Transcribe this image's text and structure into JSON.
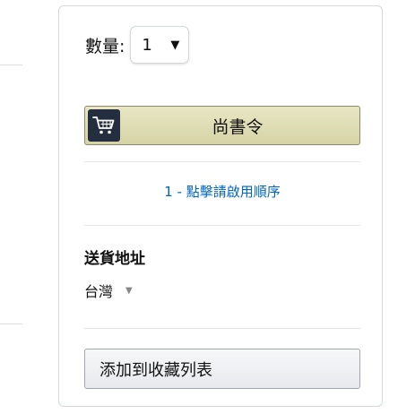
{
  "quantity": {
    "label": "數量:",
    "selected": "1",
    "arrow_icon": "caret-down-icon"
  },
  "order": {
    "button_label": "尚書令",
    "icon": "shopping-cart-icon",
    "tile_color": "#232f3e"
  },
  "one_click": {
    "link_text": "1 - 點擊請啟用順序",
    "color": "#0066c0"
  },
  "shipping": {
    "title": "送貨地址",
    "selected": "台灣",
    "arrow_icon": "caret-down-icon"
  },
  "wishlist": {
    "button_label": "添加到收藏列表"
  }
}
